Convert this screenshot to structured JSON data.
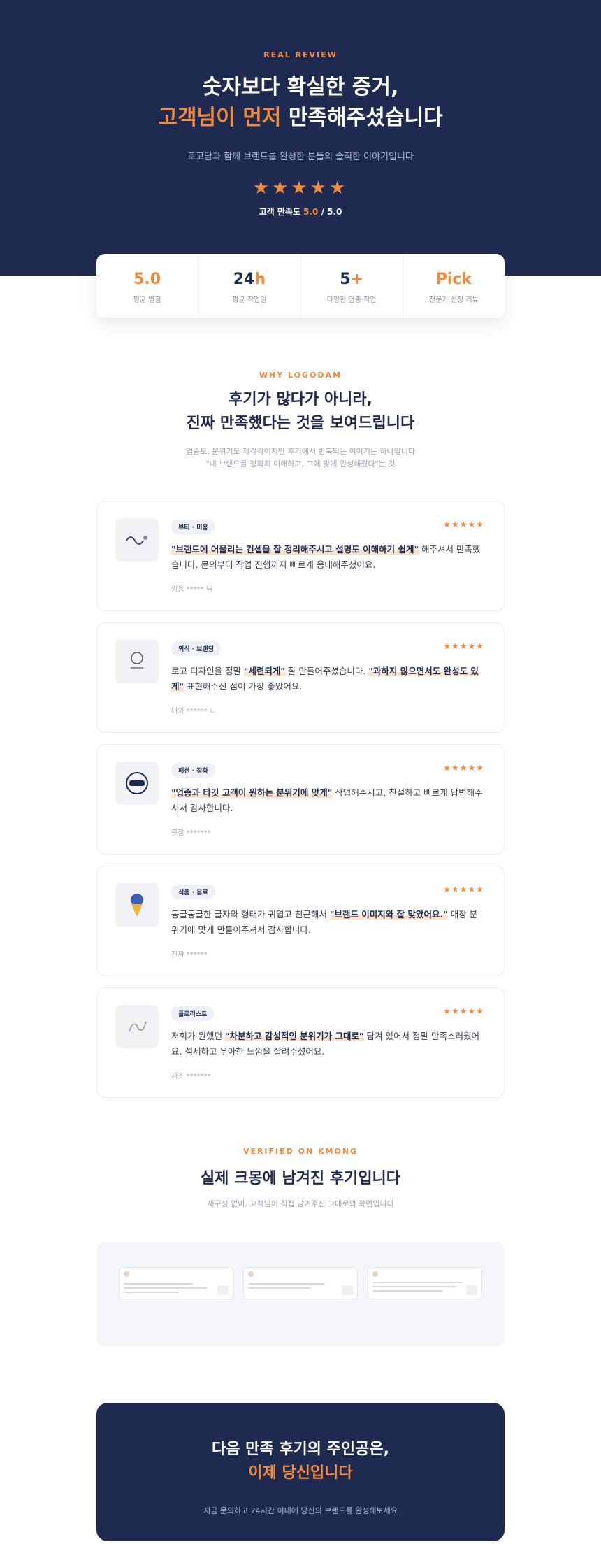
{
  "hero": {
    "eyebrow": "REAL REVIEW",
    "title_line1": "숫자보다 확실한 증거,",
    "title_accent": "고객님이 먼저",
    "title_rest": " 만족해주셨습니다",
    "subtitle": "로고담과 함께 브랜드를 완성한 분들의 솔직한 이야기입니다",
    "stars": "★★★★★",
    "rating_label": "고객 만족도 ",
    "rating_score": "5.0",
    "rating_total": " / 5.0"
  },
  "stats": [
    {
      "value": "5.0",
      "label": "평균 별점"
    },
    {
      "value_main": "24",
      "value_accent": "h",
      "label": "평균 작업일"
    },
    {
      "value_main": "5",
      "value_accent": "+",
      "label": "다양한 업종 작업"
    },
    {
      "value": "Pick",
      "label": "전문가 선정 리뷰"
    }
  ],
  "why": {
    "eyebrow": "WHY LOGODAM",
    "title_line1": "후기가 많다가 아니라,",
    "title_line2": "진짜 만족했다는 것을 보여드립니다",
    "desc_line1": "업종도, 분위기도 제각각이지만 후기에서 반복되는 이야기는 하나입니다",
    "desc_line2": "\"내 브랜드를 정확히 이해하고, 그에 맞게 완성해줬다\"는 것"
  },
  "reviews": [
    {
      "tag": "뷰티 · 미용",
      "stars": "★★★★★",
      "highlight": "\"브랜드에 어울리는 컨셉을 잘 정리해주시고 설명도 이해하기 쉽게\"",
      "text_after": " 해주셔서 만족했습니다. 문의부터 작업 진행까지 빠르게 응대해주셨어요.",
      "author": "밍용 ***** 님"
    },
    {
      "tag": "외식 · 브랜딩",
      "stars": "★★★★★",
      "text_before": "로고 디자인을 정말 ",
      "highlight": "\"세련되게\"",
      "text_mid": " 잘 만들어주셨습니다. ",
      "highlight2": "\"과하지 않으면서도 완성도 있게\"",
      "text_after": " 표현해주신 점이 가장 좋았어요.",
      "author": "너의 ****** ㄴ"
    },
    {
      "tag": "패션 · 잡화",
      "stars": "★★★★★",
      "highlight": "\"업종과 타깃 고객이 원하는 분위기에 맞게\"",
      "text_after": " 작업해주시고, 친절하고 빠르게 답변해주셔서 감사합니다.",
      "author": "관점 *******"
    },
    {
      "tag": "식품 · 음료",
      "stars": "★★★★★",
      "text_before": "동글동글한 글자와 형태가 귀엽고 친근해서 ",
      "highlight": "\"브랜드 이미지와 잘 맞았어요.\"",
      "text_after": " 매장 분위기에 맞게 만들어주셔서 감사합니다.",
      "author": "진짜 ******"
    },
    {
      "tag": "플로리스트",
      "stars": "★★★★★",
      "text_before": "저희가 원했던 ",
      "highlight": "\"차분하고 감성적인 분위기가 그대로\"",
      "text_after": " 담겨 있어서 정말 만족스러웠어요. 섬세하고 우아한 느낌을 살려주셨어요.",
      "author": "새조 *******"
    }
  ],
  "kmong": {
    "eyebrow": "VERIFIED ON KMONG",
    "title": "실제 크몽에 남겨진 후기입니다",
    "desc": "재구성 없이, 고객님이 직접 남겨주신 그대로의 화면입니다"
  },
  "cta": {
    "title_line1": "다음 만족 후기의 주인공은,",
    "title_accent": "이제 당신입니다",
    "desc": "지금 문의하고 24시간 이내에 당신의 브랜드를 완성해보세요"
  },
  "colors": {
    "navy": "#1e2a4f",
    "accent": "#f08a3c",
    "highlight": "#fde1c9"
  }
}
